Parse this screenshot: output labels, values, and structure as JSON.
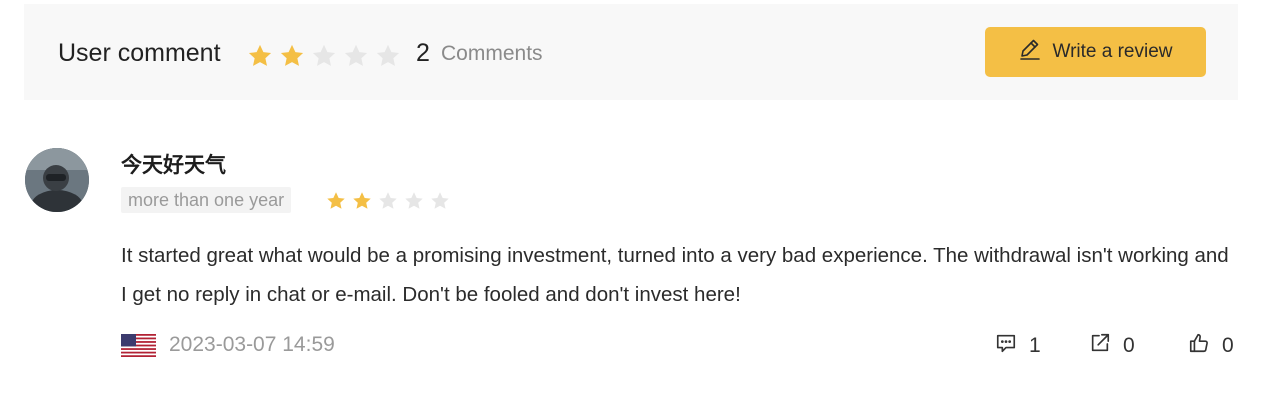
{
  "header": {
    "title": "User comment",
    "rating": 2,
    "max_rating": 5,
    "comment_count": "2",
    "comment_label": "Comments",
    "write_review_label": "Write a review",
    "write_review_icon": "edit-pen-icon"
  },
  "review": {
    "username": "今天好天气",
    "time_ago": "more than one year",
    "rating": 2,
    "max_rating": 5,
    "text": "It started great what would be a promising investment, turned into a very bad experience. The withdrawal isn't working and I get no reply in chat or e-mail. Don't be fooled and don't invest here!",
    "country_flag": "us-flag-icon",
    "date": "2023-03-07 14:59",
    "actions": {
      "comments": "1",
      "shares": "0",
      "likes": "0"
    }
  },
  "colors": {
    "accent": "#f4bf45",
    "star_filled": "#f4bf45",
    "star_empty": "#e6e6e6",
    "header_bg": "#f8f8f8",
    "muted_text": "#9a9a9a"
  }
}
